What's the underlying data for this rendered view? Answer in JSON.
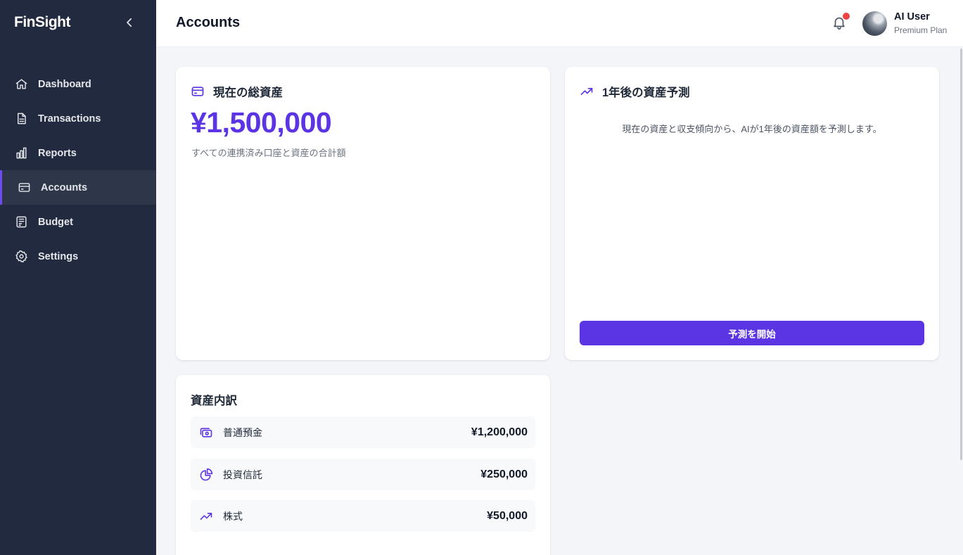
{
  "brand": "FinSight",
  "nav": {
    "items": [
      {
        "label": "Dashboard",
        "icon": "home-icon"
      },
      {
        "label": "Transactions",
        "icon": "document-icon"
      },
      {
        "label": "Reports",
        "icon": "bar-chart-icon"
      },
      {
        "label": "Accounts",
        "icon": "credit-card-icon",
        "active": true
      },
      {
        "label": "Budget",
        "icon": "calculator-icon"
      },
      {
        "label": "Settings",
        "icon": "gear-icon"
      }
    ]
  },
  "header": {
    "title": "Accounts",
    "user_name": "AI User",
    "user_plan": "Premium Plan",
    "has_notification": true
  },
  "total_assets": {
    "title": "現在の総資産",
    "value": "¥1,500,000",
    "caption": "すべての連携済み口座と資産の合計額"
  },
  "forecast": {
    "title": "1年後の資産予測",
    "description": "現在の資産と収支傾向から、AIが1年後の資産額を予測します。",
    "button_label": "予測を開始"
  },
  "breakdown": {
    "title": "資産内訳",
    "items": [
      {
        "label": "普通預金",
        "amount": "¥1,200,000",
        "icon": "cash-icon"
      },
      {
        "label": "投資信託",
        "amount": "¥250,000",
        "icon": "pie-chart-icon"
      },
      {
        "label": "株式",
        "amount": "¥50,000",
        "icon": "trending-up-icon"
      }
    ]
  },
  "colors": {
    "accent": "#5b35e3",
    "sidebar_bg": "#222a3f",
    "notification_dot": "#ef4444"
  }
}
